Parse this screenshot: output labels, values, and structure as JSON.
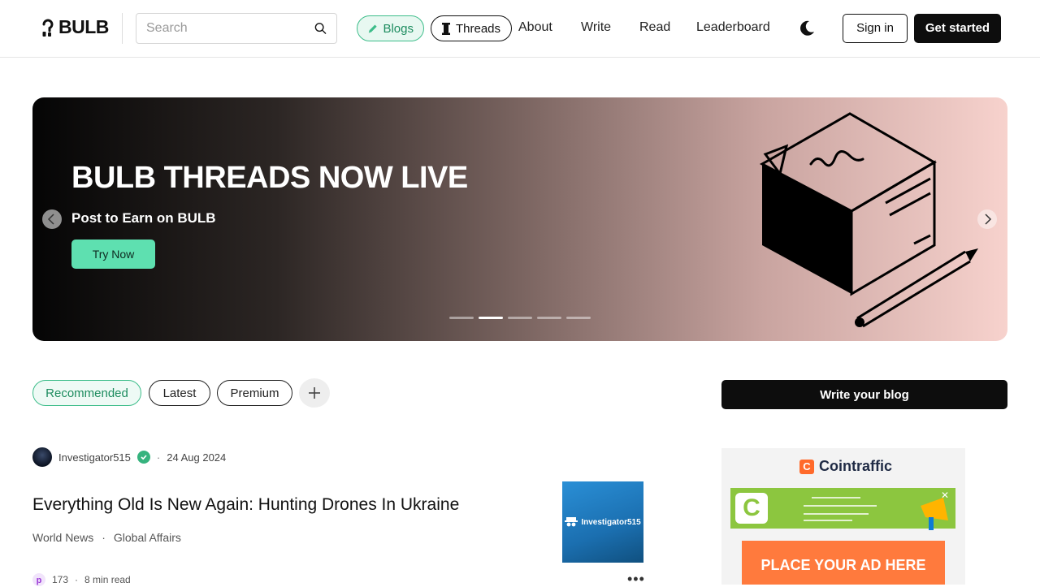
{
  "header": {
    "logo_text": "BULB",
    "search_placeholder": "Search",
    "blogs_label": "Blogs",
    "threads_label": "Threads",
    "nav": [
      "About",
      "Write",
      "Read",
      "Leaderboard"
    ],
    "signin_label": "Sign in",
    "get_started_label": "Get started"
  },
  "hero": {
    "title": "BULB THREADS NOW LIVE",
    "subtitle": "Post to Earn on BULB",
    "cta_label": "Try Now",
    "slide_count": 5,
    "active_slide": 2
  },
  "tabs": {
    "items": [
      "Recommended",
      "Latest",
      "Premium"
    ],
    "active": "Recommended",
    "add_icon": "plus-icon"
  },
  "sidebar": {
    "write_blog_label": "Write your blog",
    "ad": {
      "brand": "Cointraffic",
      "cta": "PLACE YOUR AD HERE"
    }
  },
  "article": {
    "author": "Investigator515",
    "date": "24 Aug 2024",
    "title": "Everything Old Is New Again: Hunting Drones In Ukraine",
    "tags": [
      "World News",
      "Global Affairs"
    ],
    "thumb_label": "Investigator515",
    "likes": "173",
    "read_time": "8 min read"
  },
  "colors": {
    "accent_green": "#3dbd8a",
    "hero_button": "#5ee0b0",
    "dark": "#0d0d0d"
  }
}
